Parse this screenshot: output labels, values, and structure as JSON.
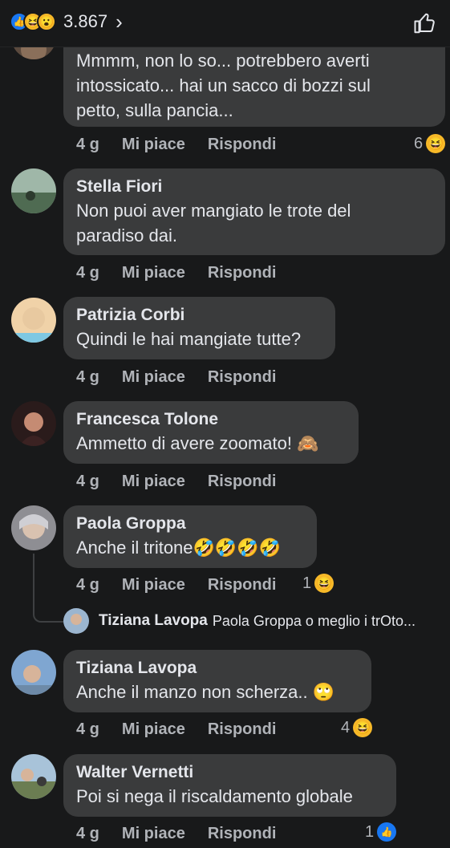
{
  "header": {
    "reaction_icons": [
      "like-icon",
      "haha-icon",
      "wow-icon"
    ],
    "reaction_count": "3.867",
    "chevron": "›"
  },
  "comments": [
    {
      "author": "",
      "lines": [
        "Mmmm, non lo so... potrebbero averti",
        "intossicato... hai un sacco di bozzi sul",
        "petto, sulla pancia..."
      ],
      "age": "4 g",
      "like": "Mi piace",
      "reply": "Rispondi",
      "reaction_count": "6",
      "reaction_icon": "haha-icon"
    },
    {
      "author": "Stella Fiori",
      "lines": [
        "Non puoi aver mangiato le trote del",
        "paradiso dai."
      ],
      "age": "4 g",
      "like": "Mi piace",
      "reply": "Rispondi"
    },
    {
      "author": "Patrizia Corbi",
      "lines": [
        "Quindi le hai mangiate tutte?"
      ],
      "age": "4 g",
      "like": "Mi piace",
      "reply": "Rispondi"
    },
    {
      "author": "Francesca Tolone",
      "lines": [
        "Ammetto di avere zoomato! 🙈"
      ],
      "age": "4 g",
      "like": "Mi piace",
      "reply": "Rispondi"
    },
    {
      "author": "Paola Groppa",
      "lines": [
        "Anche il tritone🤣🤣🤣🤣"
      ],
      "age": "4 g",
      "like": "Mi piace",
      "reply": "Rispondi",
      "reaction_count": "1",
      "reaction_icon": "haha-icon"
    },
    {
      "author": "Tiziana Lavopa",
      "lines": [
        "Anche il manzo non scherza.. 🙄"
      ],
      "age": "4 g",
      "like": "Mi piace",
      "reply": "Rispondi",
      "reaction_count": "4",
      "reaction_icon": "haha-icon"
    },
    {
      "author": "Walter Vernetti",
      "lines": [
        "Poi si nega il riscaldamento globale"
      ],
      "age": "4 g",
      "like": "Mi piace",
      "reply": "Rispondi",
      "reaction_count": "1",
      "reaction_icon": "like-icon"
    }
  ],
  "reply_preview": {
    "author": "Tiziana Lavopa",
    "text": "Paola Groppa o meglio i trOto..."
  },
  "colors": {
    "background": "#18191a",
    "bubble": "#3a3b3c",
    "text": "#e4e6eb",
    "meta": "#b0b3b8",
    "like_blue": "#1877f2",
    "haha_yellow": "#f7b928"
  }
}
